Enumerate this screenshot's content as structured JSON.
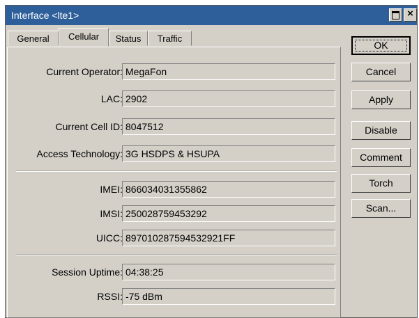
{
  "window": {
    "title": "Interface <lte1>"
  },
  "tabs": [
    {
      "label": "General"
    },
    {
      "label": "Cellular"
    },
    {
      "label": "Status"
    },
    {
      "label": "Traffic"
    }
  ],
  "active_tab": "Cellular",
  "fields": {
    "operator": {
      "label": "Current Operator:",
      "value": "MegaFon"
    },
    "lac": {
      "label": "LAC:",
      "value": "2902"
    },
    "cell_id": {
      "label": "Current Cell ID:",
      "value": "8047512"
    },
    "access_tech": {
      "label": "Access Technology:",
      "value": "3G HSDPS & HSUPA"
    },
    "imei": {
      "label": "IMEI:",
      "value": "866034031355862"
    },
    "imsi": {
      "label": "IMSI:",
      "value": "250028759453292"
    },
    "uicc": {
      "label": "UICC:",
      "value": "897010287594532921FF"
    },
    "session_uptime": {
      "label": "Session Uptime:",
      "value": "04:38:25"
    },
    "rssi": {
      "label": "RSSI:",
      "value": "-75 dBm"
    }
  },
  "buttons": {
    "ok": "OK",
    "cancel": "Cancel",
    "apply": "Apply",
    "disable": "Disable",
    "comment": "Comment",
    "torch": "Torch",
    "scan": "Scan..."
  },
  "colors": {
    "titlebar": "#2f5f9a",
    "dialog_bg": "#d4d0c8"
  }
}
